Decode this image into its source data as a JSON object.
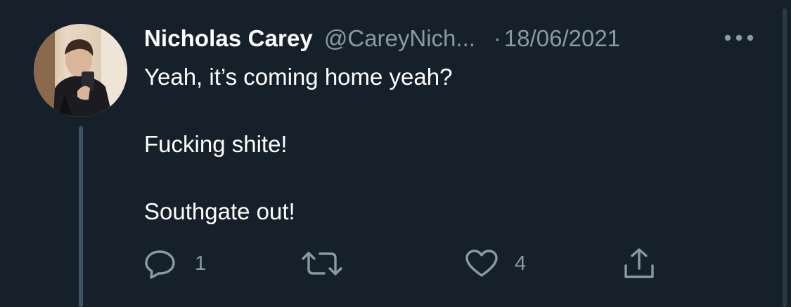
{
  "author": {
    "display_name": "Nicholas Carey",
    "handle": "@CareyNich...",
    "separator": "·",
    "date": "18/06/2021"
  },
  "tweet": {
    "lines": [
      "Yeah, it’s coming home yeah?",
      "Fucking shite!",
      "Southgate out!"
    ]
  },
  "actions": {
    "reply_count": "1",
    "retweet_count": "",
    "like_count": "4"
  },
  "colors": {
    "background": "#15202b",
    "secondary_text": "#8b98a5",
    "thread_line": "#3d5466"
  },
  "icons": {
    "more": "more-horizontal-icon",
    "reply": "reply-bubble-icon",
    "retweet": "retweet-arrows-icon",
    "like": "heart-icon",
    "share": "share-upload-icon"
  }
}
